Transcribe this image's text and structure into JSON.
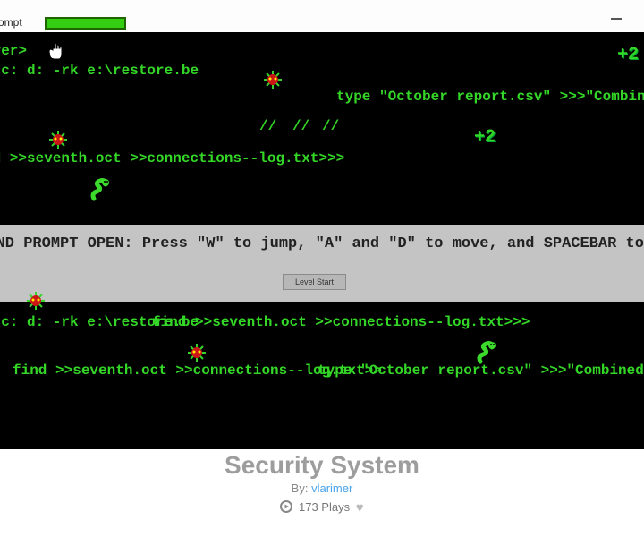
{
  "titlebar": {
    "label": "l Prompt"
  },
  "stage": {
    "line_player": "ayer>",
    "line_restore1": "e c: d: -rk e:\\restore.be",
    "line_type1": "type \"October report.csv\" >>>\"Combined repo",
    "slashes1": "//",
    "slashes2": "//",
    "slashes3": "//",
    "line_find1": "nd >>seventh.oct >>connections--log.txt>>>",
    "line_restore2": "e c: d: -rk e:\\restore.be",
    "line_find2": "find >>seventh.oct >>connections--log.txt>>>",
    "line_find3": "find >>seventh.oct >>connections--log.txt>>",
    "line_type2": "type \"October report.csv\" >>>\"Combined report.c",
    "plus2a": "+2",
    "plus2b": "+2"
  },
  "overlay": {
    "message": "MMAND PROMPT OPEN: Press \"W\" to jump, \"A\" and \"D\" to move, and SPACEBAR to shoo",
    "button": "Level Start"
  },
  "footer": {
    "title": "Security System",
    "by_label": "By:",
    "author": "vlarimer",
    "plays": "173 Plays"
  }
}
